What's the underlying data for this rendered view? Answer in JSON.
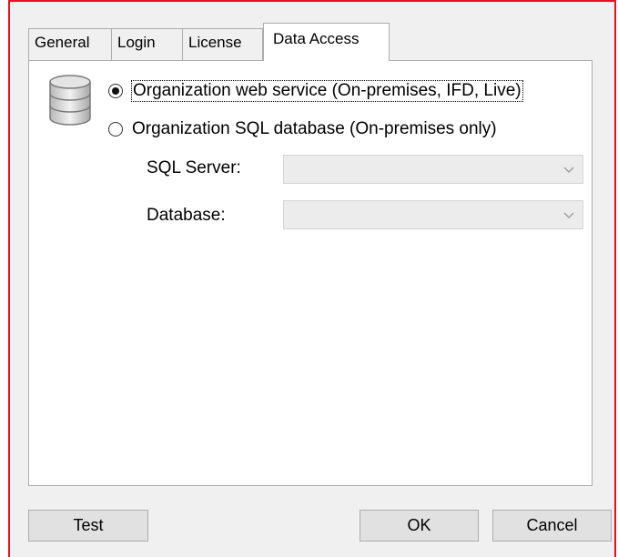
{
  "tabs": [
    {
      "label": "General"
    },
    {
      "label": "Login"
    },
    {
      "label": "License"
    },
    {
      "label": "Data Access"
    }
  ],
  "active_tab": "Data Access",
  "data_access": {
    "icon": "database-icon",
    "option_web_service": "Organization web service (On-premises, IFD, Live)",
    "option_sql": "Organization SQL database (On-premises only)",
    "selected_option": "Organization web service (On-premises, IFD, Live)",
    "sql_server_label": "SQL Server:",
    "sql_server_value": "",
    "database_label": "Database:",
    "database_value": ""
  },
  "buttons": {
    "test": "Test",
    "ok": "OK",
    "cancel": "Cancel"
  },
  "colors": {
    "window_border": "#e81123",
    "panel_background": "#ffffff",
    "dialog_background": "#f0f0f0"
  }
}
